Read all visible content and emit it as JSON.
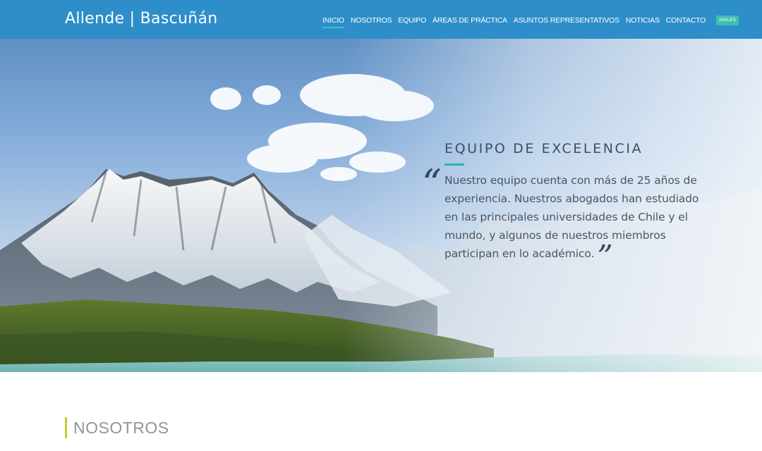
{
  "header": {
    "logo": "Allende | Bascuñán",
    "nav": [
      {
        "label": "INICIO",
        "active": true
      },
      {
        "label": "NOSOTROS"
      },
      {
        "label": "EQUIPO"
      },
      {
        "label": "ÁREAS DE PRÁCTICA"
      },
      {
        "label": "ASUNTOS REPRESENTATIVOS"
      },
      {
        "label": "NOTICIAS"
      },
      {
        "label": "CONTACTO"
      }
    ],
    "language_button": "INGLÉS"
  },
  "hero": {
    "title": "EQUIPO DE EXCELENCIA",
    "quote": "Nuestro equipo cuenta con más de 25 años de experiencia. Nuestros abogados han estudiado en las principales universidades de Chile y el mundo, y algunos de nuestros miembros participan en lo académico.",
    "quote_open": "“",
    "quote_close": "”"
  },
  "section": {
    "heading": "NOSOTROS"
  },
  "colors": {
    "header_bg": "#2d8ec9",
    "accent_teal": "#2ab3a5",
    "accent_yellow": "#c3cc34"
  }
}
